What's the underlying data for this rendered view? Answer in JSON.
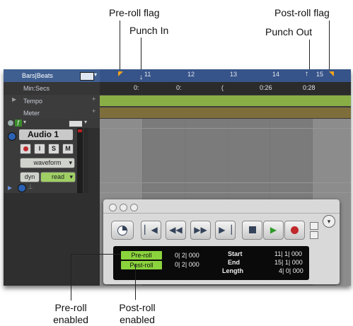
{
  "callouts": {
    "preroll_flag": "Pre-roll flag",
    "punch_in": "Punch In",
    "postroll_flag": "Post-roll flag",
    "punch_out": "Punch Out",
    "preroll_enabled_1": "Pre-roll",
    "preroll_enabled_2": "enabled",
    "postroll_enabled_1": "Post-roll",
    "postroll_enabled_2": "enabled"
  },
  "rulers": {
    "bars_beats": "Bars|Beats",
    "min_secs": "Min:Secs",
    "tempo": "Tempo",
    "meter": "Meter",
    "bar_ticks": [
      "11",
      "12",
      "13",
      "14",
      "15"
    ],
    "min_ticks": [
      "0:",
      "0:",
      "(",
      "0:26",
      "0:28"
    ]
  },
  "track": {
    "name": "Audio 1",
    "record_label": "",
    "input_label": "I",
    "solo_label": "S",
    "mute_label": "M",
    "view": "waveform",
    "dyn": "dyn",
    "auto_mode": "read"
  },
  "transport": {
    "preroll_label": "Pre-roll",
    "postroll_label": "Post-roll",
    "preroll_value": "0| 2| 000",
    "postroll_value": "0| 2| 000",
    "start_label": "Start",
    "end_label": "End",
    "length_label": "Length",
    "start_value": "11| 1| 000",
    "end_value": "15| 1| 000",
    "length_value": "4| 0| 000"
  },
  "colors": {
    "ruler_blue": "#3f5f91",
    "tempo_green": "#8aae46",
    "meter_olive": "#7e6e3b",
    "flag_orange": "#f2a31b",
    "counter_green": "#8bd33d"
  }
}
